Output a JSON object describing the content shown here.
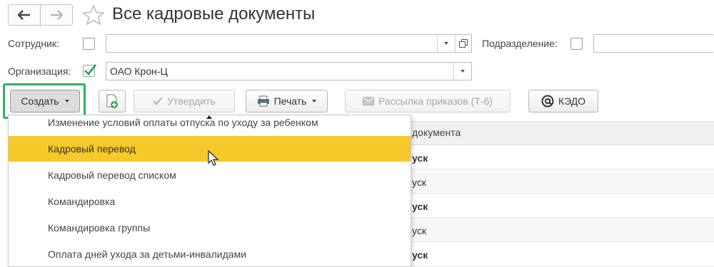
{
  "header": {
    "title": "Все кадровые документы",
    "back_icon": "arrow-left-icon",
    "forward_icon": "arrow-right-icon",
    "favorite_icon": "star-icon"
  },
  "filters": {
    "employee_label": "Сотрудник:",
    "employee_value": "",
    "department_label": "Подразделение:",
    "department_value": "",
    "organization_label": "Организация:",
    "organization_value": "ОАО Крон-Ц",
    "organization_checked": true
  },
  "toolbar": {
    "create_label": "Создать",
    "approve_label": "Утвердить",
    "print_label": "Печать",
    "mailing_label": "Рассылка приказов (Т-6)",
    "kedo_label": "КЭДО"
  },
  "table": {
    "column_header": "документа",
    "rows": [
      "уск",
      "уск",
      "уск",
      "уск",
      "уск"
    ]
  },
  "menu": {
    "items": [
      "Изменение условий оплаты отпуска по уходу за ребенком",
      "Кадровый перевод",
      "Кадровый перевод списком",
      "Командировка",
      "Командировка группы",
      "Оплата дней ухода за детьми-инвалидами"
    ],
    "active_index": 1
  },
  "colors": {
    "highlight_border": "#2db35d",
    "menu_active_bg": "#f6c82a",
    "checkmark": "#1aa34a"
  }
}
